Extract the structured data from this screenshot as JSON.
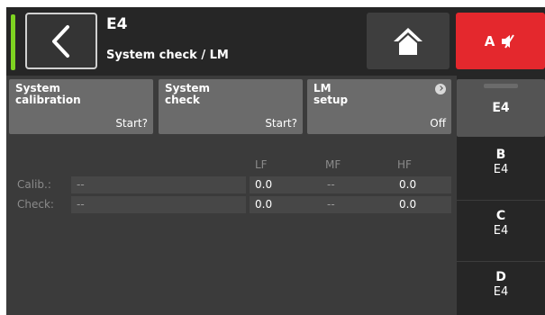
{
  "header": {
    "device_name": "E4",
    "subtitle": "System check / LM",
    "mute_label": "A"
  },
  "function_buttons": [
    {
      "title_line1": "System",
      "title_line2": "calibration",
      "value": "Start?"
    },
    {
      "title_line1": "System",
      "title_line2": "check",
      "value": "Start?"
    },
    {
      "title_line1": "LM",
      "title_line2": "setup",
      "value": "Off"
    }
  ],
  "table": {
    "columns": [
      "LF",
      "MF",
      "HF"
    ],
    "rows": [
      {
        "label": "Calib.:",
        "status": "--",
        "lf": "0.0",
        "mf": "--",
        "hf": "0.0"
      },
      {
        "label": "Check:",
        "status": "--",
        "lf": "0.0",
        "mf": "--",
        "hf": "0.0"
      }
    ]
  },
  "sidebar": {
    "active": "E4",
    "items": [
      {
        "letter": "B",
        "sub": "E4"
      },
      {
        "letter": "C",
        "sub": "E4"
      },
      {
        "letter": "D",
        "sub": "E4"
      }
    ]
  },
  "colors": {
    "status_ok": "#7ed321",
    "mute": "#e4282d",
    "background": "#3b3b3b",
    "button": "#6b6b6b"
  },
  "icons": [
    "back-chevron-icon",
    "home-icon",
    "speaker-muted-icon",
    "info-arrow-icon"
  ]
}
